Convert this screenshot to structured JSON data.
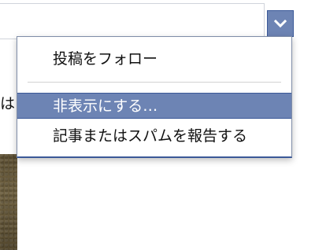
{
  "menu_button": {
    "icon": "chevron-down-icon",
    "color": "#6d84b4"
  },
  "background": {
    "partial_text": "は か"
  },
  "menu": {
    "items": [
      {
        "label": "投稿をフォロー"
      },
      {
        "label": "非表示にする…",
        "highlighted": true
      },
      {
        "label": "記事またはスパムを報告する"
      }
    ],
    "highlight_color": "#6d84b4"
  }
}
